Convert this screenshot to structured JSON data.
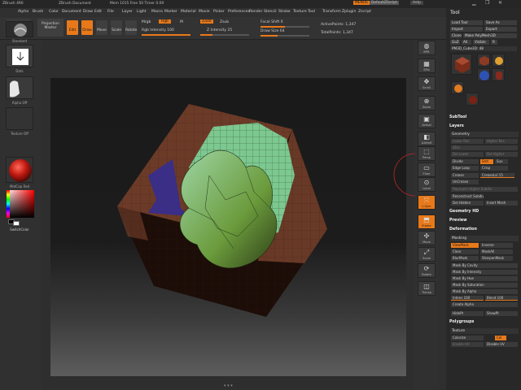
{
  "titlebar": {
    "app": "ZBrush 4R6",
    "doc": "ZBrush Document",
    "stats": "Mem 1015  Free 50  Timer 0.09",
    "help": "Help",
    "script": "DefaultZScript",
    "menus_label": "MENUS"
  },
  "menubar": {
    "items": [
      "Alpha",
      "Brush",
      "Color",
      "Document",
      "Draw",
      "Edit",
      "File",
      "Layer",
      "Light",
      "Macro",
      "Marker",
      "Material",
      "Movie",
      "Picker",
      "Preferences",
      "Render",
      "Stencil",
      "Stroke",
      "Texture",
      "Tool",
      "Transform",
      "Zplugin",
      "Zscript"
    ]
  },
  "toptools": {
    "zmapper": "ZMapper",
    "projection": "Projection Master",
    "edit": "Edit",
    "draw": "Draw",
    "move": "Move",
    "scale": "Scale",
    "rotate": "Rotate",
    "mrgb": "Mrgb",
    "rgb": "Rgb",
    "m": "M",
    "zadd": "Zadd",
    "zsub": "Zsub",
    "zcut": "Zcut",
    "rgb_intensity": "Rgb Intensity 100",
    "z_intensity": "Z Intensity 25",
    "focal_shift": "Focal Shift 0",
    "draw_size": "Draw Size 64",
    "dynamic": "Dynamic",
    "active_points": "ActivePoints: 1,347",
    "total_points": "TotalPoints: 1,347",
    "rgb_intensity_level": 1.0,
    "z_intensity_level": 0.25
  },
  "leftshelf": {
    "brush_label": "Standard",
    "stroke_label": "Dots",
    "alpha_label": "Alpha Off",
    "texture_label": "Texture Off",
    "material_label": "MatCap Red",
    "gradient_label": "Gradient",
    "switch_color": "SwitchColor"
  },
  "rightshelf": {
    "buttons": [
      {
        "icon": "bpr-icon",
        "label": "BPR"
      },
      {
        "icon": "spix-icon",
        "label": "SPix"
      },
      {
        "icon": "scroll-icon",
        "label": "Scroll"
      },
      {
        "icon": "zoom-icon",
        "label": "Zoom"
      },
      {
        "icon": "actual-icon",
        "label": "Actual"
      },
      {
        "icon": "aahalf-icon",
        "label": "AAHalf"
      },
      {
        "icon": "persp-icon",
        "label": "Persp"
      },
      {
        "icon": "floor-icon",
        "label": "Floor"
      },
      {
        "icon": "local-icon",
        "label": "Local"
      },
      {
        "icon": "xyz-icon",
        "label": "L.Sym"
      },
      {
        "icon": "frame-icon",
        "label": "Frame"
      },
      {
        "icon": "move-icon",
        "label": "Move"
      },
      {
        "icon": "scale-icon",
        "label": "Scale"
      },
      {
        "icon": "rotate-icon",
        "label": "Rotate"
      },
      {
        "icon": "transp-icon",
        "label": "Transp"
      }
    ]
  },
  "toolpanel": {
    "title": "Tool",
    "load_tool": "Load Tool",
    "save_as": "Save As",
    "import": "Import",
    "export": "Export",
    "clone": "Clone",
    "make_polymesh": "Make PolyMesh3D",
    "goz": "GoZ",
    "all": "All",
    "visible": "Visible",
    "r": "R",
    "tool_name": "PM3D_Cube3D: 48",
    "thumbs": [
      "PM3D_Cube3D",
      "Cube3D",
      "SimpleBrush",
      "Sphere3D",
      "AlphaBrush",
      "Cylinder3D"
    ],
    "subtool": "SubTool",
    "layers": "Layers",
    "geometry": "Geometry",
    "lower_res": "Lower Res",
    "higher_res": "Higher Res",
    "sdiv": "SDiv",
    "del_lower": "Del Lower",
    "del_higher": "Del Higher",
    "divide": "Divide",
    "smt": "Smt",
    "suv": "Suv",
    "edge_loop": "Edge Loop",
    "crisp": "Crisp",
    "crease": "Crease",
    "crease_lvl": "CreaseLvl 15",
    "uncrease": "UnCrease",
    "reproject": "Reproject Higher Subdiv",
    "reconstruct": "Reconstruct Subdiv",
    "del_hidden": "Del Hidden",
    "insert_mesh": "Insert Mesh",
    "geometry_hd": "Geometry HD",
    "preview": "Preview",
    "deformation": "Deformation",
    "masking": "Masking",
    "viewmask": "ViewMask",
    "inverse": "Inverse",
    "clear": "Clear",
    "maskall": "MaskAll",
    "sharpen_mask": "SharpenMask",
    "blur_mask": "BlurMask",
    "mask_cavity": "Mask By Cavity",
    "mask_intensity": "Mask By Intensity",
    "mask_hue": "Mask By Hue",
    "mask_saturation": "Mask By Saturation",
    "mask_alpha": "Mask By Alpha",
    "intensity": "Intens 100",
    "blend": "Blend 100",
    "create_alpha": "Create Alpha",
    "hide_pt": "HidePt",
    "showpt": "ShowPt",
    "polygroups": "Polygroups",
    "texture": "Texture",
    "colorize": "Colorize",
    "col": "Col",
    "enable_uv": "Enable UV",
    "disable_uv": "Disable UV"
  },
  "colors": {
    "accent": "#e8791a",
    "cube_brown": "#6b3a2a",
    "mesh_green": "#8fc98a",
    "purple": "#3a2e86"
  }
}
